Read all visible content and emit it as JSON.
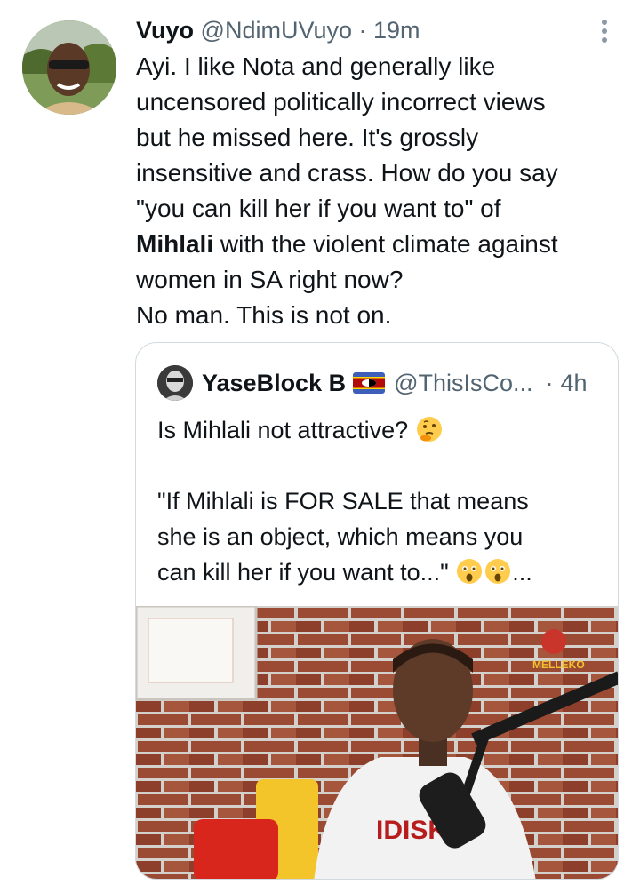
{
  "tweet": {
    "display_name": "Vuyo",
    "handle": "@NdimUVuyo",
    "separator": "·",
    "time": "19m",
    "lines_before_bold": [
      "Ayi. I like Nota and generally like",
      "uncensored politically incorrect views",
      "but he missed here. It's grossly",
      "insensitive and crass. How do you say",
      "\"you can kill her if you want to\" of"
    ],
    "bold_name": "Mihlali",
    "after_bold": " with the violent climate against",
    "lines_after": [
      "women in SA right now?",
      "No man. This is not on."
    ]
  },
  "quoted": {
    "display_name": "YaseBlock B",
    "handle": "@ThisIsCo...",
    "separator": "·",
    "time": "4h",
    "line1": "Is Mihlali not attractive?",
    "line2": "\"If Mihlali is FOR SALE that means",
    "line3": "she is an object, which means you",
    "line4": "can kill her if you want to...\"",
    "trailing": "...",
    "media_hoodie_text": "IDISK",
    "media_watermark": "MELLEKO"
  },
  "icons": {
    "more": "more-vertical-icon",
    "flag": "eswatini-flag-icon",
    "thinking": "thinking-face-emoji",
    "surprised": "astonished-face-emoji"
  },
  "colors": {
    "text": "#0f1419",
    "muted": "#536471",
    "border": "#cfd9de"
  }
}
